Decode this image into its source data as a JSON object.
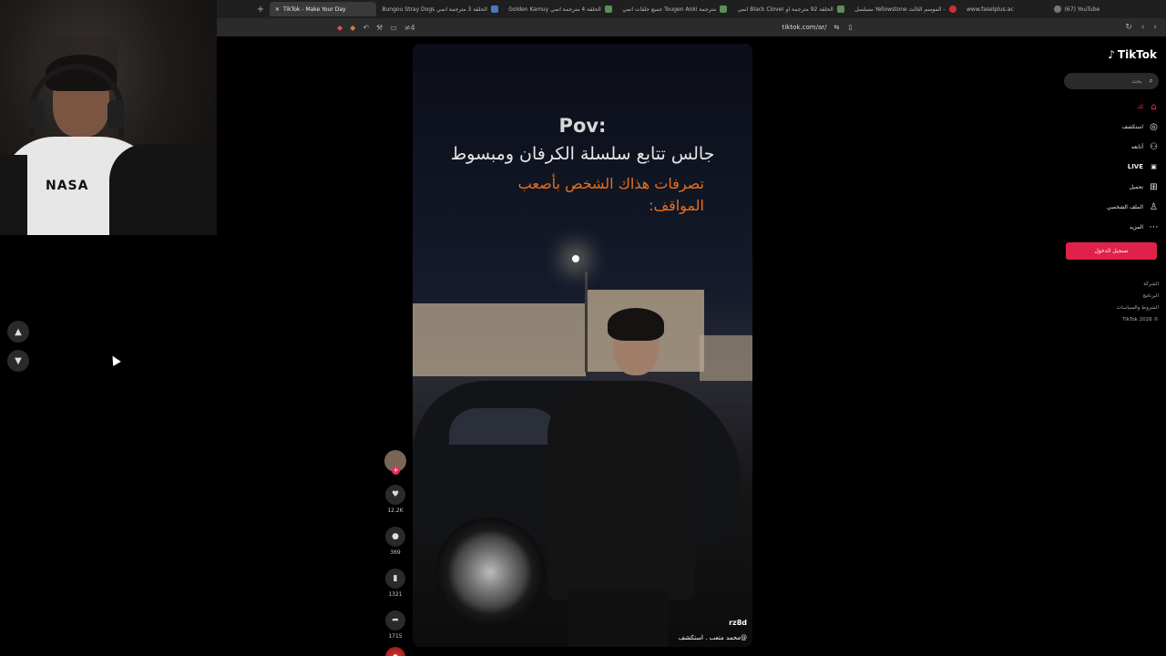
{
  "browser": {
    "tabs": [
      {
        "label": "TikTok - Make Your Day",
        "active": true
      },
      {
        "label": "Bungou Stray Dogs الحلقة 3 مترجمة انمي"
      },
      {
        "label": "Golden Kamuy الحلقة 4 مترجمة انمي"
      },
      {
        "label": "جميع حلقات انمي Tougen Anki مترجمة"
      },
      {
        "label": "انمي Black Clover الحلقة 92 مترجمة او"
      },
      {
        "label": "مسلسل Yellowstone الموسم الثالث -"
      },
      {
        "label": "www.faselplus.ac"
      },
      {
        "label": "(67) YouTube"
      }
    ],
    "new_tab": "+",
    "url": "tiktok.com/ar/",
    "toolbar_extra": "≠4"
  },
  "nav": {
    "up_icon": "chevron-up-icon",
    "down_icon": "chevron-down-icon"
  },
  "video": {
    "pov": "Pov:",
    "line1": "جالس تتابع سلسلة الكرفان ومبسوط",
    "line2": "تصرفات هذاك الشخص بأصعب المواقف:",
    "watermark": "rz8d",
    "caption": "@محمد متعب . استكشف",
    "accent": "#e8701f"
  },
  "actions": {
    "likes": "12.2K",
    "comments": "369",
    "saves": "1321",
    "shares": "1715"
  },
  "sidebar": {
    "logo": "TikTok",
    "search_placeholder": "بحث",
    "items": [
      {
        "label": "لك",
        "icon": "home-icon"
      },
      {
        "label": "استكشف",
        "icon": "compass-icon"
      },
      {
        "label": "أتابعه",
        "icon": "user-follow-icon"
      },
      {
        "label": "LIVE",
        "icon": "live-icon"
      },
      {
        "label": "تحميل",
        "icon": "upload-icon"
      },
      {
        "label": "الملف الشخصي",
        "icon": "profile-icon"
      },
      {
        "label": "المزيد",
        "icon": "more-icon"
      }
    ],
    "login_label": "تسجيل الدخول",
    "footer": [
      "الشركة",
      "البرنامج",
      "الشروط والسياسات",
      "© 2026 TikTok"
    ],
    "brand_color": "#fe2c55"
  }
}
